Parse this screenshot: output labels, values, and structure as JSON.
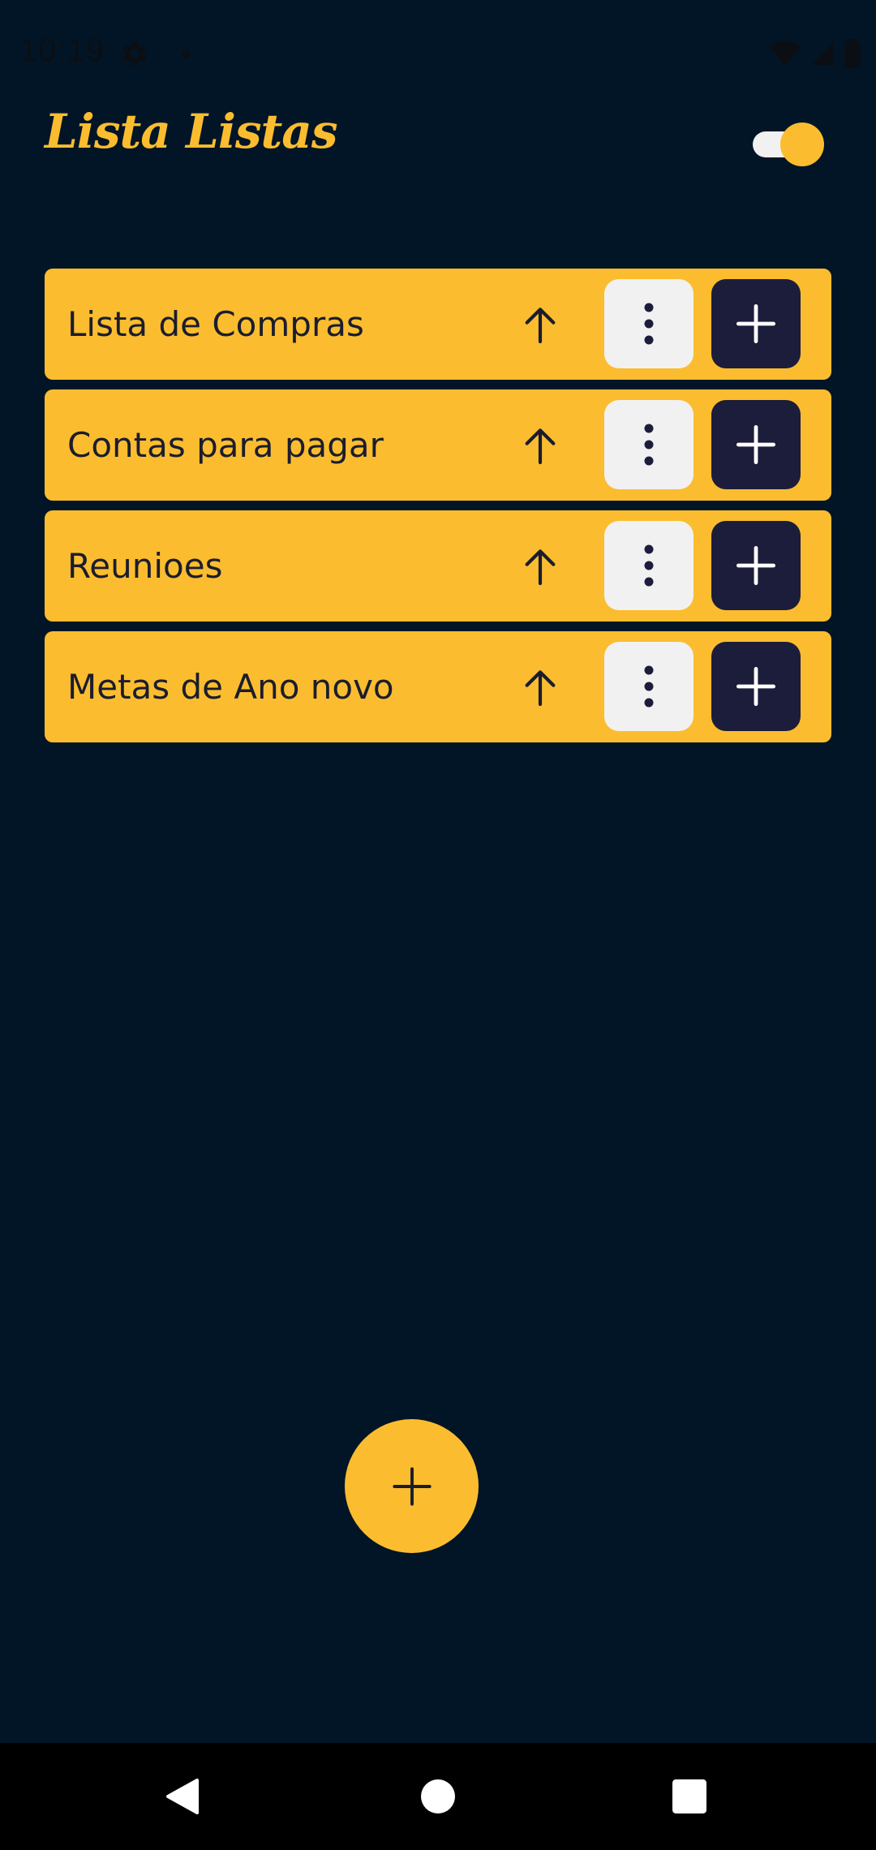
{
  "status_bar": {
    "time": "10:19"
  },
  "header": {
    "title": "Lista Listas",
    "theme_toggle_on": true
  },
  "lists": [
    {
      "label": "Lista de Compras"
    },
    {
      "label": "Contas para pagar"
    },
    {
      "label": "Reunioes"
    },
    {
      "label": "Metas de Ano novo"
    }
  ],
  "icons": {
    "up": "arrow-up-icon",
    "menu": "more-vert-icon",
    "add": "plus-icon",
    "fab": "plus-icon"
  },
  "colors": {
    "background": "#021526",
    "accent": "#fbbd2f",
    "dark_button": "#1b1d3a",
    "light_button": "#f1f1f1"
  }
}
